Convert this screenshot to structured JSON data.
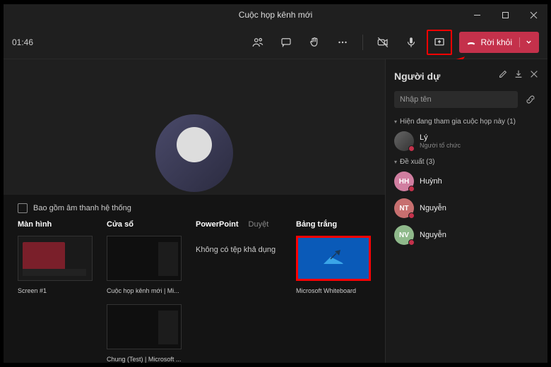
{
  "titlebar": {
    "title": "Cuộc họp kênh mới"
  },
  "toolbar": {
    "timer": "01:46",
    "leave": "Rời khỏi"
  },
  "share_tray": {
    "system_audio": "Bao gồm âm thanh hệ thống",
    "cols": {
      "screen": "Màn hình",
      "window": "Cửa sổ",
      "powerpoint": "PowerPoint",
      "browse": "Duyệt",
      "whiteboard": "Bảng trắng"
    },
    "no_file": "Không có tệp khả dụng",
    "thumbs": {
      "screen1": "Screen #1",
      "meeting": "Cuộc họp kênh mới | Mi...",
      "chung": "Chung (Test) | Microsoft ...",
      "whiteboard": "Microsoft Whiteboard"
    }
  },
  "panel": {
    "title": "Người dự",
    "search_placeholder": "Nhập tên",
    "in_meeting": "Hiện đang tham gia cuộc họp này (1)",
    "suggested": "Đề xuất (3)",
    "attendees": [
      {
        "name": "Lý",
        "sub": "Người tổ chức",
        "av": "av-ly",
        "initials": ""
      },
      {
        "name": "Huỳnh",
        "sub": "",
        "av": "av-hh",
        "initials": "HH"
      },
      {
        "name": "Nguyễn",
        "sub": "",
        "av": "av-nt",
        "initials": "NT"
      },
      {
        "name": "Nguyễn",
        "sub": "",
        "av": "av-nv",
        "initials": "NV"
      }
    ]
  }
}
